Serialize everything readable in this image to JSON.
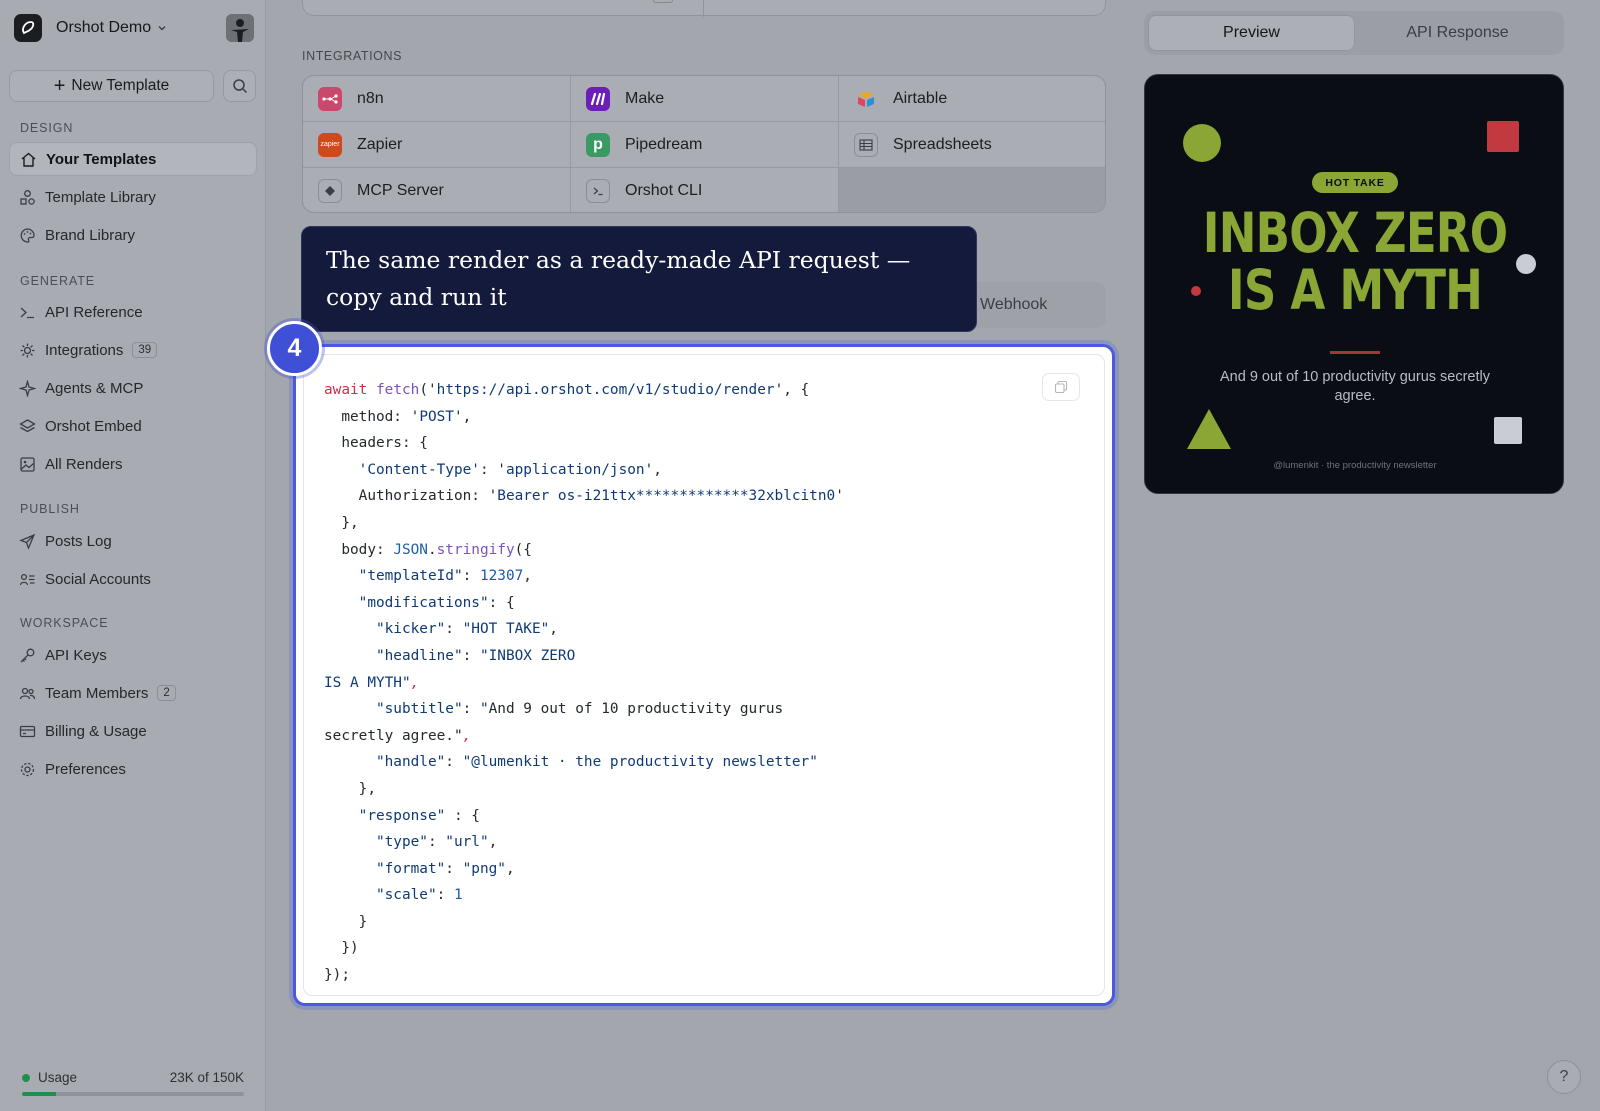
{
  "workspace": {
    "name": "Orshot Demo"
  },
  "sidebar": {
    "new_template_label": "New Template",
    "sections": {
      "design": "DESIGN",
      "generate": "GENERATE",
      "publish": "PUBLISH",
      "workspace": "WORKSPACE"
    },
    "items": {
      "your_templates": "Your Templates",
      "template_library": "Template Library",
      "brand_library": "Brand Library",
      "api_reference": "API Reference",
      "integrations": "Integrations",
      "integrations_count": "39",
      "agents_mcp": "Agents & MCP",
      "orshot_embed": "Orshot Embed",
      "all_renders": "All Renders",
      "posts_log": "Posts Log",
      "social_accounts": "Social Accounts",
      "api_keys": "API Keys",
      "team_members": "Team Members",
      "team_members_count": "2",
      "billing_usage": "Billing & Usage",
      "preferences": "Preferences"
    },
    "usage": {
      "label": "Usage",
      "value": "23K of 150K",
      "fraction": 0.153
    }
  },
  "integrations": {
    "title": "INTEGRATIONS",
    "items": [
      {
        "label": "n8n",
        "icon": "n8n-icon",
        "color": "#c9486b"
      },
      {
        "label": "Make",
        "icon": "make-icon",
        "color": "#6b1fb8"
      },
      {
        "label": "Airtable",
        "icon": "airtable-icon",
        "color": "#e8a72c"
      },
      {
        "label": "Zapier",
        "icon": "zapier-icon",
        "color": "#d0481e"
      },
      {
        "label": "Pipedream",
        "icon": "pipedream-icon",
        "color": "#3a9a64"
      },
      {
        "label": "Spreadsheets",
        "icon": "spreadsheet-icon",
        "color": "#555a62"
      },
      {
        "label": "MCP Server",
        "icon": "mcp-icon",
        "color": "#555a62"
      },
      {
        "label": "Orshot CLI",
        "icon": "terminal-icon",
        "color": "#555a62"
      }
    ]
  },
  "tabs": {
    "webhook": "Webhook"
  },
  "tooltip": {
    "step": "4",
    "text": "The same render as a ready-made API request — copy and run it"
  },
  "code": {
    "language": "javascript",
    "url": "https://api.orshot.com/v1/studio/render",
    "method": "POST",
    "content_type": "application/json",
    "authorization": "Bearer os-i21ttx*************32xblcitn0",
    "template_id": "12307",
    "modifications": {
      "kicker": "HOT TAKE",
      "headline": "INBOX ZERO\nIS A MYTH",
      "subtitle": "And 9 out of 10 productivity gurus\nsecretly agree.",
      "handle": "@lumenkit · the productivity newsletter"
    },
    "response": {
      "type": "url",
      "format": "png",
      "scale": "1"
    }
  },
  "right_panel": {
    "tab_preview": "Preview",
    "tab_api_response": "API Response",
    "preview": {
      "kicker": "HOT TAKE",
      "headline_line1": "INBOX ZERO",
      "headline_line2": "IS A MYTH",
      "subtitle": "And 9 out of 10 productivity gurus secretly agree.",
      "handle": "@lumenkit · the productivity newsletter",
      "colors": {
        "background": "#0a0d13",
        "accent": "#8aa634",
        "red": "#c03a40",
        "gray": "#c9ccd2"
      }
    }
  },
  "help_label": "?"
}
